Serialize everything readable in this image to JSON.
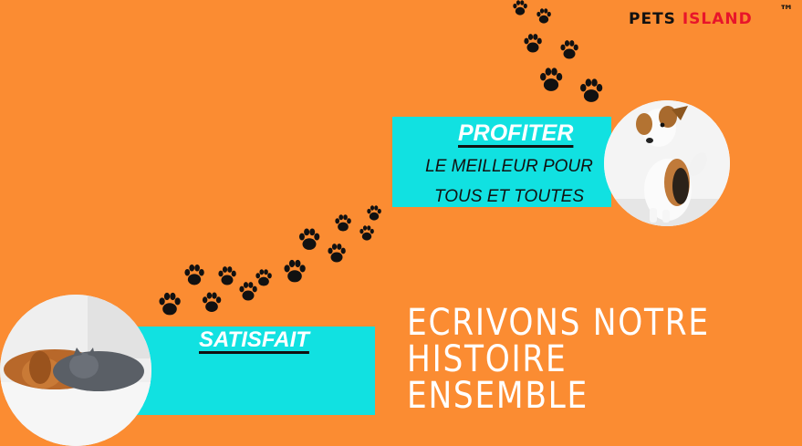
{
  "brand": {
    "name_part1": "PETS ",
    "name_part2": "ISLAND",
    "trademark": "™"
  },
  "top_panel": {
    "title": "PROFITER",
    "line1": "LE MEILLEUR POUR",
    "line2": "TOUS ET TOUTES"
  },
  "bottom_panel": {
    "title": "SATISFAIT"
  },
  "headline": {
    "line1": "ECRIVONS  NOTRE",
    "line2": "HISTOIRE  ENSEMBLE"
  },
  "colors": {
    "background": "#fb8c32",
    "panel": "#11e1e1",
    "brand_accent": "#e8152a"
  },
  "icons": [
    "paw-print-icon",
    "dog-photo",
    "dog-and-cat-photo"
  ]
}
